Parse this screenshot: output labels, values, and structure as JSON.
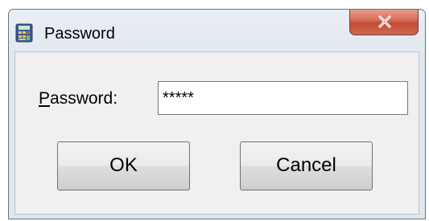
{
  "window": {
    "title": "Password",
    "app_icon": "calculator-app-icon",
    "close_icon": "close-x-icon",
    "close_button_color": "#c64a33"
  },
  "form": {
    "password_label_mnemonic": "P",
    "password_label_rest": "assword:",
    "password_value": "*****"
  },
  "buttons": {
    "ok_label": "OK",
    "cancel_label": "Cancel"
  }
}
